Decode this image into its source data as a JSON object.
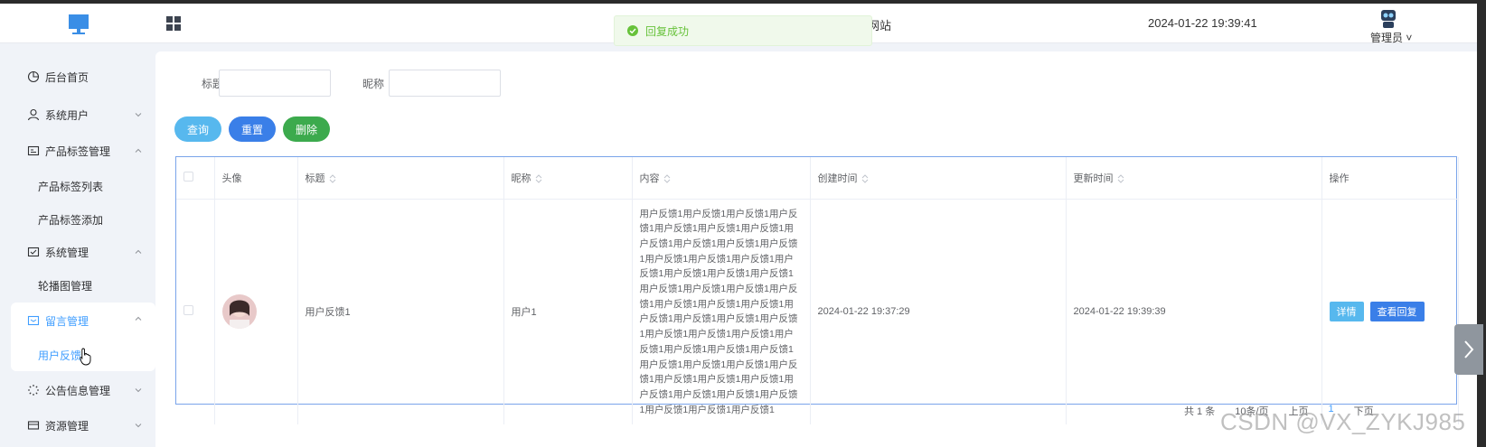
{
  "header": {
    "site_title_fragment": "网站",
    "datetime": "2024-01-22 19:39:41",
    "user_name": "管理员",
    "user_caret": "˅"
  },
  "toast": {
    "message": "回复成功"
  },
  "sidebar": {
    "items": [
      {
        "label": "后台首页",
        "icon": "dashboard-icon"
      },
      {
        "label": "系统用户",
        "icon": "user-icon",
        "expanded": false
      },
      {
        "label": "产品标签管理",
        "icon": "tag-icon",
        "expanded": true,
        "children": [
          "产品标签列表",
          "产品标签添加"
        ]
      },
      {
        "label": "系统管理",
        "icon": "system-icon",
        "expanded": true,
        "children": [
          "轮播图管理"
        ]
      },
      {
        "label": "留言管理",
        "icon": "message-icon",
        "expanded": true,
        "active": true,
        "children": [
          "用户反馈"
        ]
      },
      {
        "label": "公告信息管理",
        "icon": "notice-icon",
        "expanded": false
      },
      {
        "label": "资源管理",
        "icon": "resource-icon",
        "expanded": false
      }
    ]
  },
  "search": {
    "title_label": "标题",
    "title_value": "",
    "nickname_label": "昵称",
    "nickname_value": ""
  },
  "buttons": {
    "query": "查询",
    "reset": "重置",
    "delete": "删除"
  },
  "table": {
    "columns": [
      "头像",
      "标题",
      "昵称",
      "内容",
      "创建时间",
      "更新时间",
      "操作"
    ],
    "rows": [
      {
        "title": "用户反馈1",
        "nickname": "用户1",
        "content": "用户反馈1用户反馈1用户反馈1用户反馈1用户反馈1用户反馈1用户反馈1用户反馈1用户反馈1用户反馈1用户反馈1用户反馈1用户反馈1用户反馈1用户反馈1用户反馈1用户反馈1用户反馈1用户反馈1用户反馈1用户反馈1用户反馈1用户反馈1用户反馈1用户反馈1用户反馈1用户反馈1用户反馈1用户反馈1用户反馈1用户反馈1用户反馈1用户反馈1用户反馈1用户反馈1用户反馈1用户反馈1用户反馈1用户反馈1用户反馈1用户反馈1用户反馈1用户反馈1用户反馈1用户反馈1用户反馈1用户反馈1用户反馈1用户反馈1用户反馈1",
        "created": "2024-01-22 19:37:29",
        "updated": "2024-01-22 19:39:39",
        "detail_label": "详情",
        "reply_label": "查看回复"
      }
    ]
  },
  "pagination": {
    "total": "共 1 条",
    "page_size": "10条/页",
    "prev": "上页",
    "current": "1",
    "next": "下页"
  },
  "watermark": "CSDN @VX_ZYKJ985",
  "colors": {
    "primary": "#409eff",
    "query_btn": "#57b8ee",
    "reset_btn": "#3a7fe8",
    "delete_btn": "#3caa4d",
    "success": "#67c23a"
  }
}
